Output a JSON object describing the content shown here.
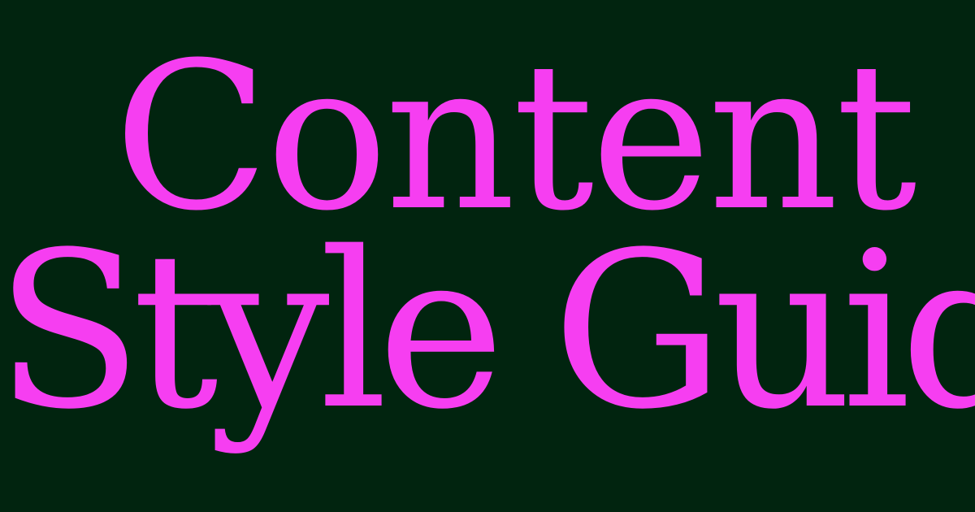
{
  "colors": {
    "background": "#01240f",
    "title_text": "#f63ef1"
  },
  "title": {
    "line1": "Content",
    "line2": "Style Guide"
  }
}
